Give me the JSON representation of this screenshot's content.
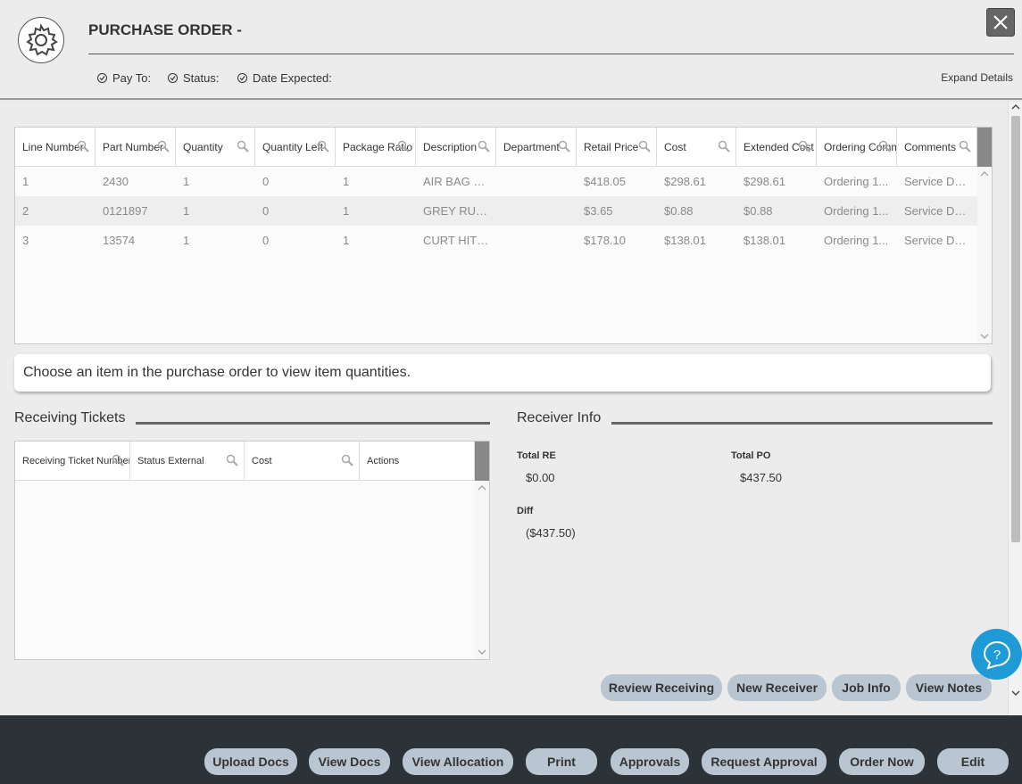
{
  "header": {
    "title": "PURCHASE ORDER -",
    "meta": {
      "pay_to": "Pay To:",
      "status": "Status:",
      "date_expected": "Date Expected:"
    },
    "expand_details": "Expand Details"
  },
  "lines_table": {
    "columns": [
      "Line Number",
      "Part Number",
      "Quantity",
      "Quantity Left",
      "Package Ratio",
      "Description",
      "Department",
      "Retail Price",
      "Cost",
      "Extended Cost",
      "Ordering Comm",
      "Comments"
    ],
    "rows": [
      [
        "1",
        "2430",
        "1",
        "0",
        "1",
        "AIR BAG KIT",
        "",
        "$418.05",
        "$298.61",
        "$298.61",
        "Ordering 1...",
        "Service Do..."
      ],
      [
        "2",
        "0121897",
        "1",
        "0",
        "1",
        "GREY RUB...",
        "",
        "$3.65",
        "$0.88",
        "$0.88",
        "Ordering 1...",
        "Service Do..."
      ],
      [
        "3",
        "13574",
        "1",
        "0",
        "1",
        "CURT HITCH",
        "",
        "$178.10",
        "$138.01",
        "$138.01",
        "Ordering 1...",
        "Service Do..."
      ]
    ]
  },
  "notice": "Choose an item in the purchase order to view item quantities.",
  "receiving": {
    "title": "Receiving Tickets",
    "columns": [
      "Receiving Ticket Number",
      "Status External",
      "Cost",
      "Actions"
    ]
  },
  "receiver_info": {
    "title": "Receiver Info",
    "total_re_label": "Total RE",
    "total_re_value": "$0.00",
    "total_po_label": "Total PO",
    "total_po_value": "$437.50",
    "diff_label": "Diff",
    "diff_value": "($437.50)"
  },
  "content_buttons": {
    "review_receiving": "Review Receiving",
    "new_receiver": "New Receiver",
    "job_info": "Job Info",
    "view_notes": "View Notes"
  },
  "footer_buttons": {
    "upload_docs": "Upload Docs",
    "view_docs": "View Docs",
    "view_allocation": "View Allocation",
    "print": "Print",
    "approvals": "Approvals",
    "request_approval": "Request Approval",
    "order_now": "Order Now",
    "edit": "Edit"
  },
  "icons": {
    "settings": "gear-icon",
    "close": "close-icon",
    "search": "search-icon",
    "help": "help-chat-icon"
  },
  "colors": {
    "button_bg": "#b9c6d2",
    "footer_bg": "#2c3338",
    "help_bg": "#1e9bd7"
  }
}
